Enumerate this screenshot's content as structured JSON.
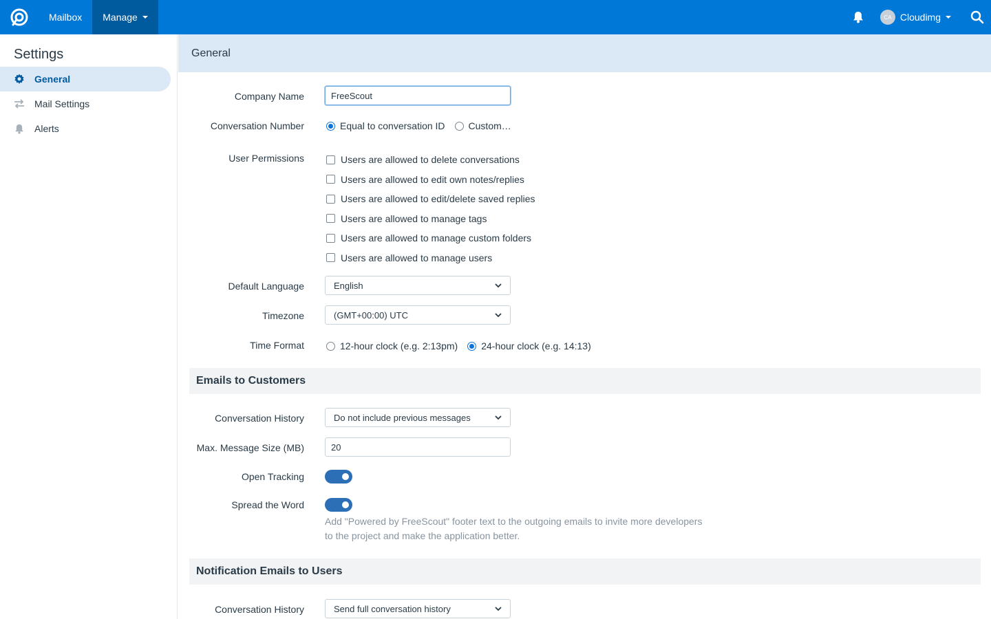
{
  "topbar": {
    "nav": [
      {
        "label": "Mailbox",
        "active": false
      },
      {
        "label": "Manage",
        "active": true
      }
    ],
    "user_initials": "CA",
    "user_name": "Cloudimg",
    "icons": {
      "logo": "freescout-logo-icon",
      "bell": "bell-icon",
      "search": "search-icon"
    }
  },
  "sidebar": {
    "title": "Settings",
    "items": [
      {
        "label": "General",
        "icon": "gear-icon",
        "active": true
      },
      {
        "label": "Mail Settings",
        "icon": "arrows-icon",
        "active": false
      },
      {
        "label": "Alerts",
        "icon": "bell-icon",
        "active": false
      }
    ]
  },
  "main": {
    "section_title": "General",
    "company_name": {
      "label": "Company Name",
      "value": "FreeScout"
    },
    "conversation_number": {
      "label": "Conversation Number",
      "options": [
        {
          "label": "Equal to conversation ID",
          "checked": true
        },
        {
          "label": "Custom…",
          "checked": false
        }
      ]
    },
    "user_permissions": {
      "label": "User Permissions",
      "options": [
        "Users are allowed to delete conversations",
        "Users are allowed to edit own notes/replies",
        "Users are allowed to edit/delete saved replies",
        "Users are allowed to manage tags",
        "Users are allowed to manage custom folders",
        "Users are allowed to manage users"
      ]
    },
    "default_language": {
      "label": "Default Language",
      "value": "English"
    },
    "timezone": {
      "label": "Timezone",
      "value": "(GMT+00:00) UTC"
    },
    "time_format": {
      "label": "Time Format",
      "options": [
        {
          "label": "12-hour clock (e.g. 2:13pm)",
          "checked": false
        },
        {
          "label": "24-hour clock (e.g. 14:13)",
          "checked": true
        }
      ]
    },
    "emails_to_customers": {
      "title": "Emails to Customers",
      "conversation_history": {
        "label": "Conversation History",
        "value": "Do not include previous messages"
      },
      "max_message_size": {
        "label": "Max. Message Size (MB)",
        "value": "20"
      },
      "open_tracking": {
        "label": "Open Tracking",
        "on": true
      },
      "spread_the_word": {
        "label": "Spread the Word",
        "on": true,
        "help": "Add \"Powered by FreeScout\" footer text to the outgoing emails to invite more developers to the project and make the application better."
      }
    },
    "notification_emails": {
      "title": "Notification Emails to Users",
      "conversation_history": {
        "label": "Conversation History",
        "value": "Send full conversation history"
      }
    }
  }
}
